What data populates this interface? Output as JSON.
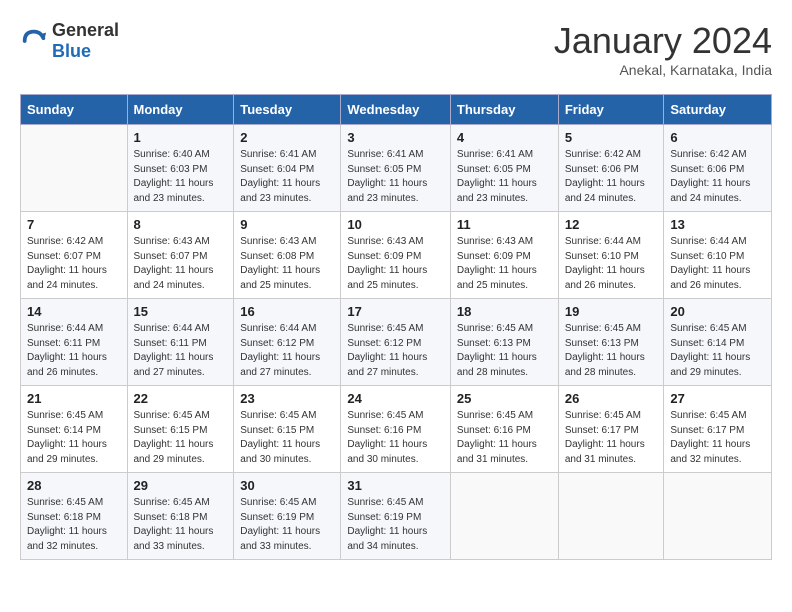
{
  "header": {
    "logo_general": "General",
    "logo_blue": "Blue",
    "month_title": "January 2024",
    "subtitle": "Anekal, Karnataka, India"
  },
  "days_of_week": [
    "Sunday",
    "Monday",
    "Tuesday",
    "Wednesday",
    "Thursday",
    "Friday",
    "Saturday"
  ],
  "weeks": [
    [
      {
        "day": "",
        "sunrise": "",
        "sunset": "",
        "daylight": ""
      },
      {
        "day": "1",
        "sunrise": "Sunrise: 6:40 AM",
        "sunset": "Sunset: 6:03 PM",
        "daylight": "Daylight: 11 hours and 23 minutes."
      },
      {
        "day": "2",
        "sunrise": "Sunrise: 6:41 AM",
        "sunset": "Sunset: 6:04 PM",
        "daylight": "Daylight: 11 hours and 23 minutes."
      },
      {
        "day": "3",
        "sunrise": "Sunrise: 6:41 AM",
        "sunset": "Sunset: 6:05 PM",
        "daylight": "Daylight: 11 hours and 23 minutes."
      },
      {
        "day": "4",
        "sunrise": "Sunrise: 6:41 AM",
        "sunset": "Sunset: 6:05 PM",
        "daylight": "Daylight: 11 hours and 23 minutes."
      },
      {
        "day": "5",
        "sunrise": "Sunrise: 6:42 AM",
        "sunset": "Sunset: 6:06 PM",
        "daylight": "Daylight: 11 hours and 24 minutes."
      },
      {
        "day": "6",
        "sunrise": "Sunrise: 6:42 AM",
        "sunset": "Sunset: 6:06 PM",
        "daylight": "Daylight: 11 hours and 24 minutes."
      }
    ],
    [
      {
        "day": "7",
        "sunrise": "Sunrise: 6:42 AM",
        "sunset": "Sunset: 6:07 PM",
        "daylight": "Daylight: 11 hours and 24 minutes."
      },
      {
        "day": "8",
        "sunrise": "Sunrise: 6:43 AM",
        "sunset": "Sunset: 6:07 PM",
        "daylight": "Daylight: 11 hours and 24 minutes."
      },
      {
        "day": "9",
        "sunrise": "Sunrise: 6:43 AM",
        "sunset": "Sunset: 6:08 PM",
        "daylight": "Daylight: 11 hours and 25 minutes."
      },
      {
        "day": "10",
        "sunrise": "Sunrise: 6:43 AM",
        "sunset": "Sunset: 6:09 PM",
        "daylight": "Daylight: 11 hours and 25 minutes."
      },
      {
        "day": "11",
        "sunrise": "Sunrise: 6:43 AM",
        "sunset": "Sunset: 6:09 PM",
        "daylight": "Daylight: 11 hours and 25 minutes."
      },
      {
        "day": "12",
        "sunrise": "Sunrise: 6:44 AM",
        "sunset": "Sunset: 6:10 PM",
        "daylight": "Daylight: 11 hours and 26 minutes."
      },
      {
        "day": "13",
        "sunrise": "Sunrise: 6:44 AM",
        "sunset": "Sunset: 6:10 PM",
        "daylight": "Daylight: 11 hours and 26 minutes."
      }
    ],
    [
      {
        "day": "14",
        "sunrise": "Sunrise: 6:44 AM",
        "sunset": "Sunset: 6:11 PM",
        "daylight": "Daylight: 11 hours and 26 minutes."
      },
      {
        "day": "15",
        "sunrise": "Sunrise: 6:44 AM",
        "sunset": "Sunset: 6:11 PM",
        "daylight": "Daylight: 11 hours and 27 minutes."
      },
      {
        "day": "16",
        "sunrise": "Sunrise: 6:44 AM",
        "sunset": "Sunset: 6:12 PM",
        "daylight": "Daylight: 11 hours and 27 minutes."
      },
      {
        "day": "17",
        "sunrise": "Sunrise: 6:45 AM",
        "sunset": "Sunset: 6:12 PM",
        "daylight": "Daylight: 11 hours and 27 minutes."
      },
      {
        "day": "18",
        "sunrise": "Sunrise: 6:45 AM",
        "sunset": "Sunset: 6:13 PM",
        "daylight": "Daylight: 11 hours and 28 minutes."
      },
      {
        "day": "19",
        "sunrise": "Sunrise: 6:45 AM",
        "sunset": "Sunset: 6:13 PM",
        "daylight": "Daylight: 11 hours and 28 minutes."
      },
      {
        "day": "20",
        "sunrise": "Sunrise: 6:45 AM",
        "sunset": "Sunset: 6:14 PM",
        "daylight": "Daylight: 11 hours and 29 minutes."
      }
    ],
    [
      {
        "day": "21",
        "sunrise": "Sunrise: 6:45 AM",
        "sunset": "Sunset: 6:14 PM",
        "daylight": "Daylight: 11 hours and 29 minutes."
      },
      {
        "day": "22",
        "sunrise": "Sunrise: 6:45 AM",
        "sunset": "Sunset: 6:15 PM",
        "daylight": "Daylight: 11 hours and 29 minutes."
      },
      {
        "day": "23",
        "sunrise": "Sunrise: 6:45 AM",
        "sunset": "Sunset: 6:15 PM",
        "daylight": "Daylight: 11 hours and 30 minutes."
      },
      {
        "day": "24",
        "sunrise": "Sunrise: 6:45 AM",
        "sunset": "Sunset: 6:16 PM",
        "daylight": "Daylight: 11 hours and 30 minutes."
      },
      {
        "day": "25",
        "sunrise": "Sunrise: 6:45 AM",
        "sunset": "Sunset: 6:16 PM",
        "daylight": "Daylight: 11 hours and 31 minutes."
      },
      {
        "day": "26",
        "sunrise": "Sunrise: 6:45 AM",
        "sunset": "Sunset: 6:17 PM",
        "daylight": "Daylight: 11 hours and 31 minutes."
      },
      {
        "day": "27",
        "sunrise": "Sunrise: 6:45 AM",
        "sunset": "Sunset: 6:17 PM",
        "daylight": "Daylight: 11 hours and 32 minutes."
      }
    ],
    [
      {
        "day": "28",
        "sunrise": "Sunrise: 6:45 AM",
        "sunset": "Sunset: 6:18 PM",
        "daylight": "Daylight: 11 hours and 32 minutes."
      },
      {
        "day": "29",
        "sunrise": "Sunrise: 6:45 AM",
        "sunset": "Sunset: 6:18 PM",
        "daylight": "Daylight: 11 hours and 33 minutes."
      },
      {
        "day": "30",
        "sunrise": "Sunrise: 6:45 AM",
        "sunset": "Sunset: 6:19 PM",
        "daylight": "Daylight: 11 hours and 33 minutes."
      },
      {
        "day": "31",
        "sunrise": "Sunrise: 6:45 AM",
        "sunset": "Sunset: 6:19 PM",
        "daylight": "Daylight: 11 hours and 34 minutes."
      },
      {
        "day": "",
        "sunrise": "",
        "sunset": "",
        "daylight": ""
      },
      {
        "day": "",
        "sunrise": "",
        "sunset": "",
        "daylight": ""
      },
      {
        "day": "",
        "sunrise": "",
        "sunset": "",
        "daylight": ""
      }
    ]
  ]
}
